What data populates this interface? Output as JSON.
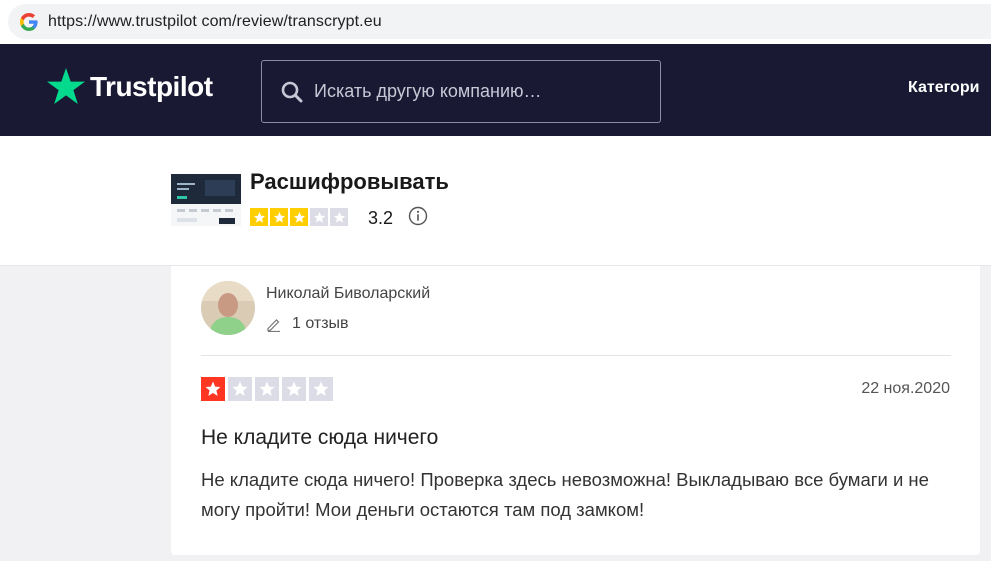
{
  "browser": {
    "url": "https://www.trustpilot com/review/transcrypt.eu",
    "search_engine_icon": "google-g-icon"
  },
  "header": {
    "logo_text": "Trustpilot",
    "logo_icon": "star-icon",
    "search_placeholder": "Искать другую компанию…",
    "nav_categories": "Категори",
    "colors": {
      "background": "#191933",
      "logo_star": "#04da8d"
    }
  },
  "company": {
    "name": "Расшифровывать",
    "score": "3.2",
    "rating_stars": 3,
    "rating_color": "#ffce00"
  },
  "review": {
    "author": "Николай Биволарский",
    "review_count": "1 отзыв",
    "rating": 1,
    "rating_color": "#ff3722",
    "date": "22 ноя.2020",
    "title": "Не кладите сюда ничего",
    "body": "Не кладите сюда ничего! Проверка здесь невозможна! Выкладываю все бумаги и не могу пройти! Мои деньги остаются там под замком!"
  }
}
